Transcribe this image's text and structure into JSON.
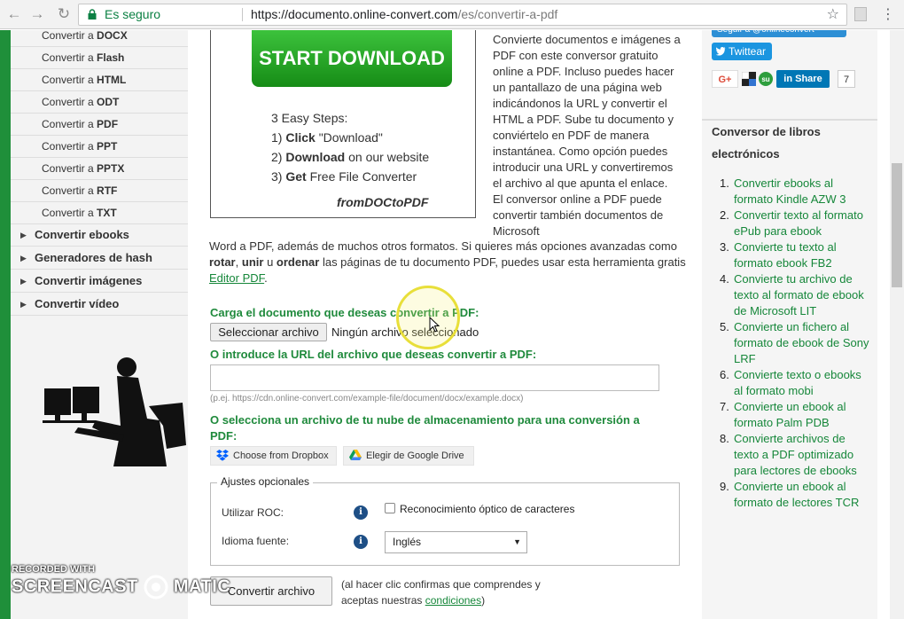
{
  "browser": {
    "secure_label": "Es seguro",
    "url_domain": "https://documento.online-convert.com",
    "url_path": "/es/convertir-a-pdf"
  },
  "sidebar": {
    "sub_prefix": "Convertir a",
    "sub_items": [
      "DOCX",
      "Flash",
      "HTML",
      "ODT",
      "PDF",
      "PPT",
      "PPTX",
      "RTF",
      "TXT"
    ],
    "categories": [
      "Convertir ebooks",
      "Generadores de hash",
      "Convertir imágenes",
      "Convertir vídeo"
    ]
  },
  "ad": {
    "button": "START DOWNLOAD",
    "steps_title": "3 Easy Steps:",
    "step1_bold": "Click",
    "step1_rest": "\"Download\"",
    "step2_bold": "Download",
    "step2_rest": "on our website",
    "step3_bold": "Get",
    "step3_rest": "Free File Converter",
    "logo": "fromDOCtoPDF"
  },
  "content": {
    "desc_narrow": "Convierte documentos e imágenes a PDF con este conversor gratuito online a PDF. Incluso puedes hacer un pantallazo de una página web indicándonos la URL y convertir el HTML a PDF. Sube tu documento y conviértelo en PDF de manera instantánea. Como opción puedes introducir una URL y convertiremos el archivo al que apunta el enlace. El conversor online a PDF puede convertir también documentos de Microsoft",
    "desc_wide_1": "Word a PDF, además de muchos otros formatos. Si quieres más opciones avanzadas como",
    "rotar": "rotar",
    "comma": ",",
    "unir": "unir",
    "u": "u",
    "ordenar": "ordenar",
    "desc_wide_2": "las páginas de tu documento PDF, puedes usar esta herramienta gratis",
    "editor_link": "Editor PDF",
    "period": ".",
    "upload_heading": "Carga el documento que deseas convertir a PDF:",
    "file_button": "Seleccionar archivo",
    "file_status": "Ningún archivo seleccionado",
    "url_heading": "O introduce la URL del archivo que deseas convertir a PDF:",
    "url_placeholder": "(p.ej. https://cdn.online-convert.com/example-file/document/docx/example.docx)",
    "cloud_heading": "O selecciona un archivo de tu nube de almacenamiento para una conversión a PDF:",
    "dropbox": "Choose from Dropbox",
    "gdrive": "Elegir de Google Drive",
    "options_legend": "Ajustes opcionales",
    "ocr_label": "Utilizar ROC:",
    "ocr_checkbox": "Reconocimiento óptico de caracteres",
    "lang_label": "Idioma fuente:",
    "lang_value": "Inglés",
    "convert_button": "Convertir archivo",
    "confirm_1": "(al hacer clic confirmas que comprendes y",
    "confirm_2": "aceptas nuestras",
    "conditions_link": "condiciones",
    "confirm_close": ")"
  },
  "right": {
    "twitter_follow": "Seguir a @onlineconvert",
    "twitter_tweet": "Twittear",
    "gplus": "G+",
    "linkedin_share": "Share",
    "share_count": "7",
    "heading": "Conversor de libros electrónicos",
    "links": [
      "Convertir ebooks al formato Kindle AZW 3",
      "Convertir texto al formato ePub para ebook",
      "Convierte tu texto al formato ebook FB2",
      "Convierte tu archivo de texto al formato de ebook de Microsoft LIT",
      "Convierte un fichero al formato de ebook de Sony LRF",
      "Convierte texto o ebooks al formato mobi",
      "Convierte un ebook al formato Palm PDB",
      "Convierte archivos de texto a PDF optimizado para lectores de ebooks",
      "Convierte un ebook al formato de lectores TCR"
    ],
    "numbers": [
      "1.",
      "2.",
      "3.",
      "4.",
      "5.",
      "6.",
      "7.",
      "8.",
      "9."
    ]
  },
  "watermark": {
    "line1": "RECORDED WITH",
    "line2a": "SCREENCAST",
    "line2b": "MATIC"
  },
  "colors": {
    "brand_green": "#1f8a3c",
    "link_green": "#16873a",
    "twitter": "#1b95e0",
    "linkedin": "#0077b5"
  }
}
